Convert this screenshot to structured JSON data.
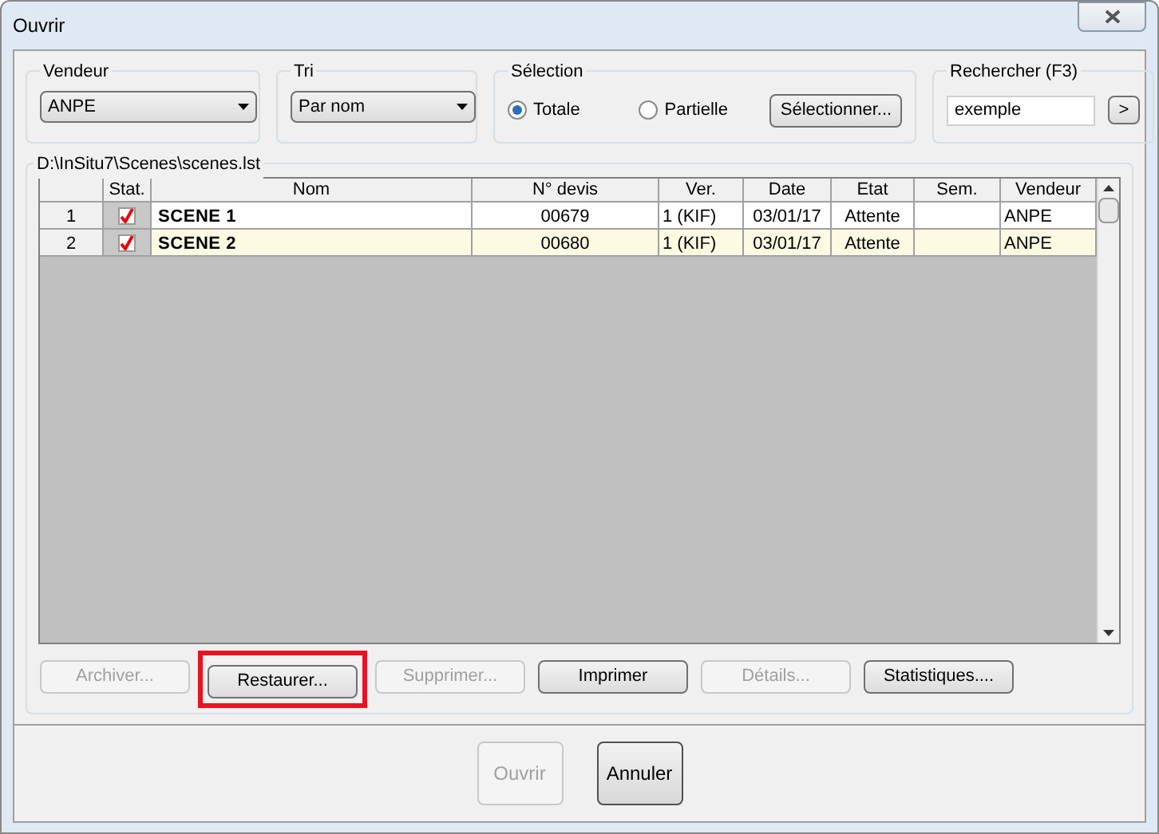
{
  "window": {
    "title": "Ouvrir"
  },
  "filters": {
    "vendeur": {
      "label": "Vendeur",
      "value": "ANPE"
    },
    "tri": {
      "label": "Tri",
      "value": "Par nom"
    },
    "selection": {
      "label": "Sélection",
      "options": [
        {
          "label": "Totale",
          "selected": true
        },
        {
          "label": "Partielle",
          "selected": false
        }
      ],
      "button": "Sélectionner..."
    },
    "search": {
      "label": "Rechercher (F3)",
      "value": "exemple",
      "button": ">"
    }
  },
  "path": "D:\\InSitu7\\Scenes\\scenes.lst",
  "table": {
    "stat_column": "Stat.",
    "columns": [
      "Nom",
      "N° devis",
      "Ver.",
      "Date",
      "Etat",
      "Sem.",
      "Vendeur"
    ],
    "rows": [
      {
        "num": "1",
        "checked": true,
        "selected": false,
        "cells": [
          "SCENE 1",
          "00679",
          "1 (KIF)",
          "03/01/17",
          "Attente",
          "",
          "ANPE"
        ]
      },
      {
        "num": "2",
        "checked": true,
        "selected": true,
        "cells": [
          "SCENE 2",
          "00680",
          "1 (KIF)",
          "03/01/17",
          "Attente",
          "",
          "ANPE"
        ]
      }
    ]
  },
  "actions": [
    {
      "label": "Archiver...",
      "disabled": true,
      "highlighted": false
    },
    {
      "label": "Restaurer...",
      "disabled": false,
      "highlighted": true
    },
    {
      "label": "Supprimer...",
      "disabled": true,
      "highlighted": false
    },
    {
      "label": "Imprimer",
      "disabled": false,
      "highlighted": false
    },
    {
      "label": "Détails...",
      "disabled": true,
      "highlighted": false
    },
    {
      "label": "Statistiques....",
      "disabled": false,
      "highlighted": false
    }
  ],
  "footer": [
    {
      "label": "Ouvrir",
      "disabled": true
    },
    {
      "label": "Annuler",
      "disabled": false
    }
  ]
}
